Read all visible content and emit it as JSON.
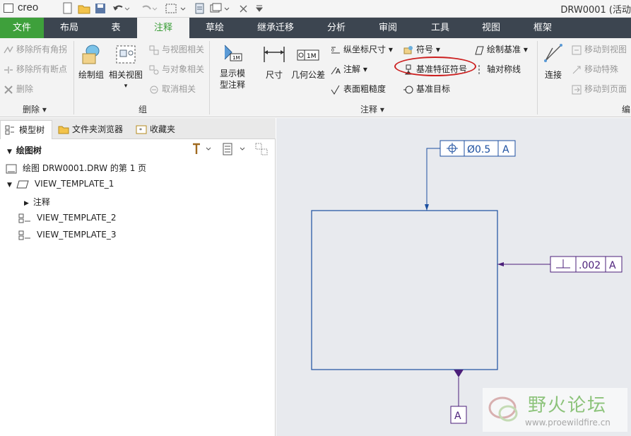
{
  "titlebar": {
    "logo": "creo",
    "title": "DRW0001 (活动"
  },
  "menu": {
    "tabs": [
      "文件",
      "布局",
      "表",
      "注释",
      "草绘",
      "继承迁移",
      "分析",
      "审阅",
      "工具",
      "视图",
      "框架"
    ]
  },
  "ribbon": {
    "delete_group": {
      "items": [
        "移除所有角拐",
        "移除所有断点",
        "删除"
      ],
      "label": "删除"
    },
    "group_group": {
      "big": [
        "绘制组",
        "相关视图"
      ],
      "items": [
        "与视图相关",
        "与对象相关",
        "取消相关"
      ],
      "label": "组"
    },
    "annot_group": {
      "show_model": "显示模型注释",
      "dimension": "尺寸",
      "gtol": "几何公差",
      "ordinate": "纵坐标尺寸",
      "note": "注解",
      "surface_finish": "表面粗糙度",
      "symbol": "符号",
      "datum_feature_symbol": "基准特征符号",
      "datum_target": "基准目标",
      "draw_datum": "绘制基准",
      "axis_symmetry": "轴对称线",
      "label": "注释"
    },
    "edit_group": {
      "connect": "连接",
      "items": [
        "移动到视图",
        "移动特殊",
        "移动到页面"
      ],
      "label": "编"
    }
  },
  "leftpanel": {
    "tabs": [
      "模型树",
      "文件夹浏览器",
      "收藏夹"
    ],
    "tree_title": "绘图树",
    "items": [
      "绘图 DRW0001.DRW 的第 1 页",
      "VIEW_TEMPLATE_1",
      "注释",
      "VIEW_TEMPLATE_2",
      "VIEW_TEMPLATE_3"
    ]
  },
  "drawing": {
    "fcf_top": {
      "tolerance": "Ø0.5",
      "datum": "A"
    },
    "fcf_right": {
      "tolerance": ".002",
      "datum": "A"
    },
    "datum_label": "A"
  },
  "watermark": {
    "name": "野火论坛",
    "url": "www.proewildfire.cn"
  },
  "colors": {
    "menubar": "#3c4550",
    "file_tab": "#3ea03b",
    "active_text": "#3b9e38",
    "drawing_blue": "#1c4fa0",
    "leader_purple": "#4b1f7a",
    "highlight_red": "#cc2020"
  }
}
